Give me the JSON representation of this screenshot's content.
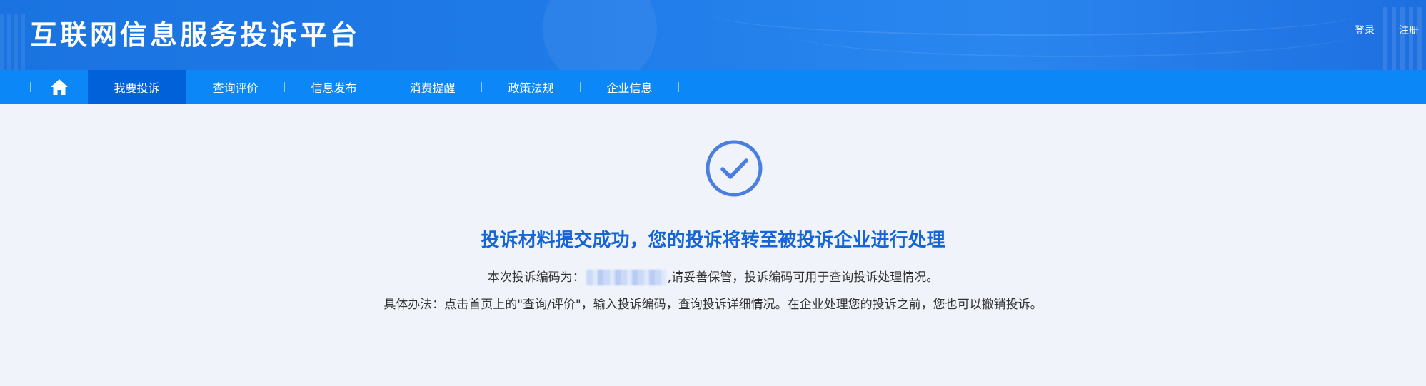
{
  "header": {
    "site_title": "互联网信息服务投诉平台",
    "login": "登录",
    "register": "注册"
  },
  "nav": {
    "home_icon": "home-icon",
    "items": [
      {
        "label": "我要投诉",
        "active": true
      },
      {
        "label": "查询评价",
        "active": false
      },
      {
        "label": "信息发布",
        "active": false
      },
      {
        "label": "消费提醒",
        "active": false
      },
      {
        "label": "政策法规",
        "active": false
      },
      {
        "label": "企业信息",
        "active": false
      }
    ]
  },
  "result": {
    "icon": "check-circle-icon",
    "title": "投诉材料提交成功，您的投诉将转至被投诉企业进行处理",
    "code_prefix": "本次投诉编码为：",
    "code_suffix": ",请妥善保管，投诉编码可用于查询投诉处理情况。",
    "method": "具体办法：点击首页上的\"查询/评价\"，输入投诉编码，查询投诉详细情况。在企业处理您的投诉之前，您也可以撤销投诉。"
  },
  "colors": {
    "header_blue": "#1f7be8",
    "nav_blue": "#0b87f7",
    "nav_active": "#0061d9",
    "title_blue": "#1565d8",
    "check_blue": "#4a7ee0",
    "background": "#f0f4fa"
  }
}
